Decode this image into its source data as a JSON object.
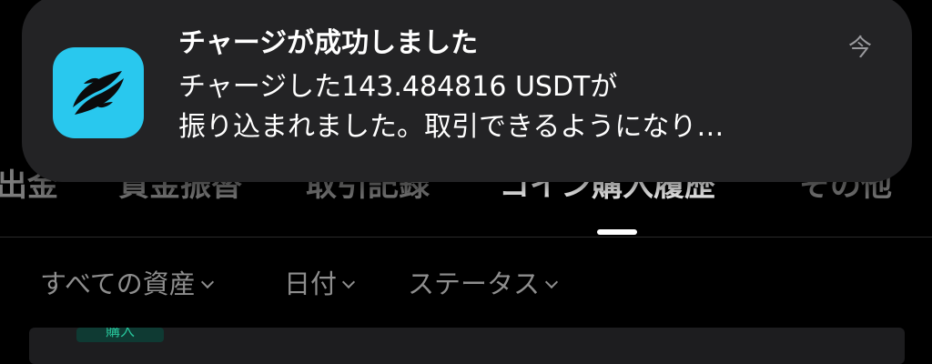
{
  "tabs": [
    {
      "label": "出金",
      "active": false
    },
    {
      "label": "資金振替",
      "active": false
    },
    {
      "label": "取引記録",
      "active": false
    },
    {
      "label": "コイン購入履歴",
      "active": true
    },
    {
      "label": "その他",
      "active": false
    }
  ],
  "filters": [
    {
      "label": "すべての資産"
    },
    {
      "label": "日付"
    },
    {
      "label": "ステータス"
    }
  ],
  "record": {
    "badge": "購入"
  },
  "notification": {
    "title": "チャージが成功しました",
    "body_line1": "チャージした143.484816 USDTが",
    "body_line2": "振り込まれました。取引できるようになり…",
    "time": "今",
    "icon": "exchange-app-icon",
    "icon_color": "#29c8ee"
  },
  "colors": {
    "background": "#000000",
    "banner": "#232325",
    "tab_active": "#ffffff",
    "tab_inactive": "#7d7d7d",
    "badge_text": "#27c39a"
  }
}
